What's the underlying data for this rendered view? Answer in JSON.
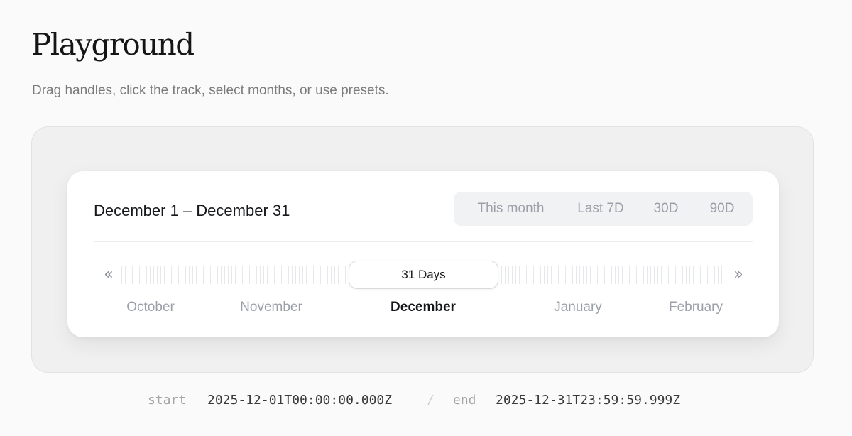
{
  "page": {
    "title": "Playground",
    "subtitle": "Drag handles, click the track, select months, or use presets."
  },
  "picker": {
    "range_label": "December 1 – December 31",
    "presets": [
      "This month",
      "Last 7D",
      "30D",
      "90D"
    ],
    "prev_glyph": "«",
    "next_glyph": "»",
    "selection_label": "31 Days",
    "months": [
      "October",
      "November",
      "December",
      "January",
      "February"
    ],
    "active_month": "December"
  },
  "output": {
    "start_label": "start",
    "start_value": "2025-12-01T00:00:00.000Z",
    "separator": "/",
    "end_label": "end",
    "end_value": "2025-12-31T23:59:59.999Z"
  }
}
